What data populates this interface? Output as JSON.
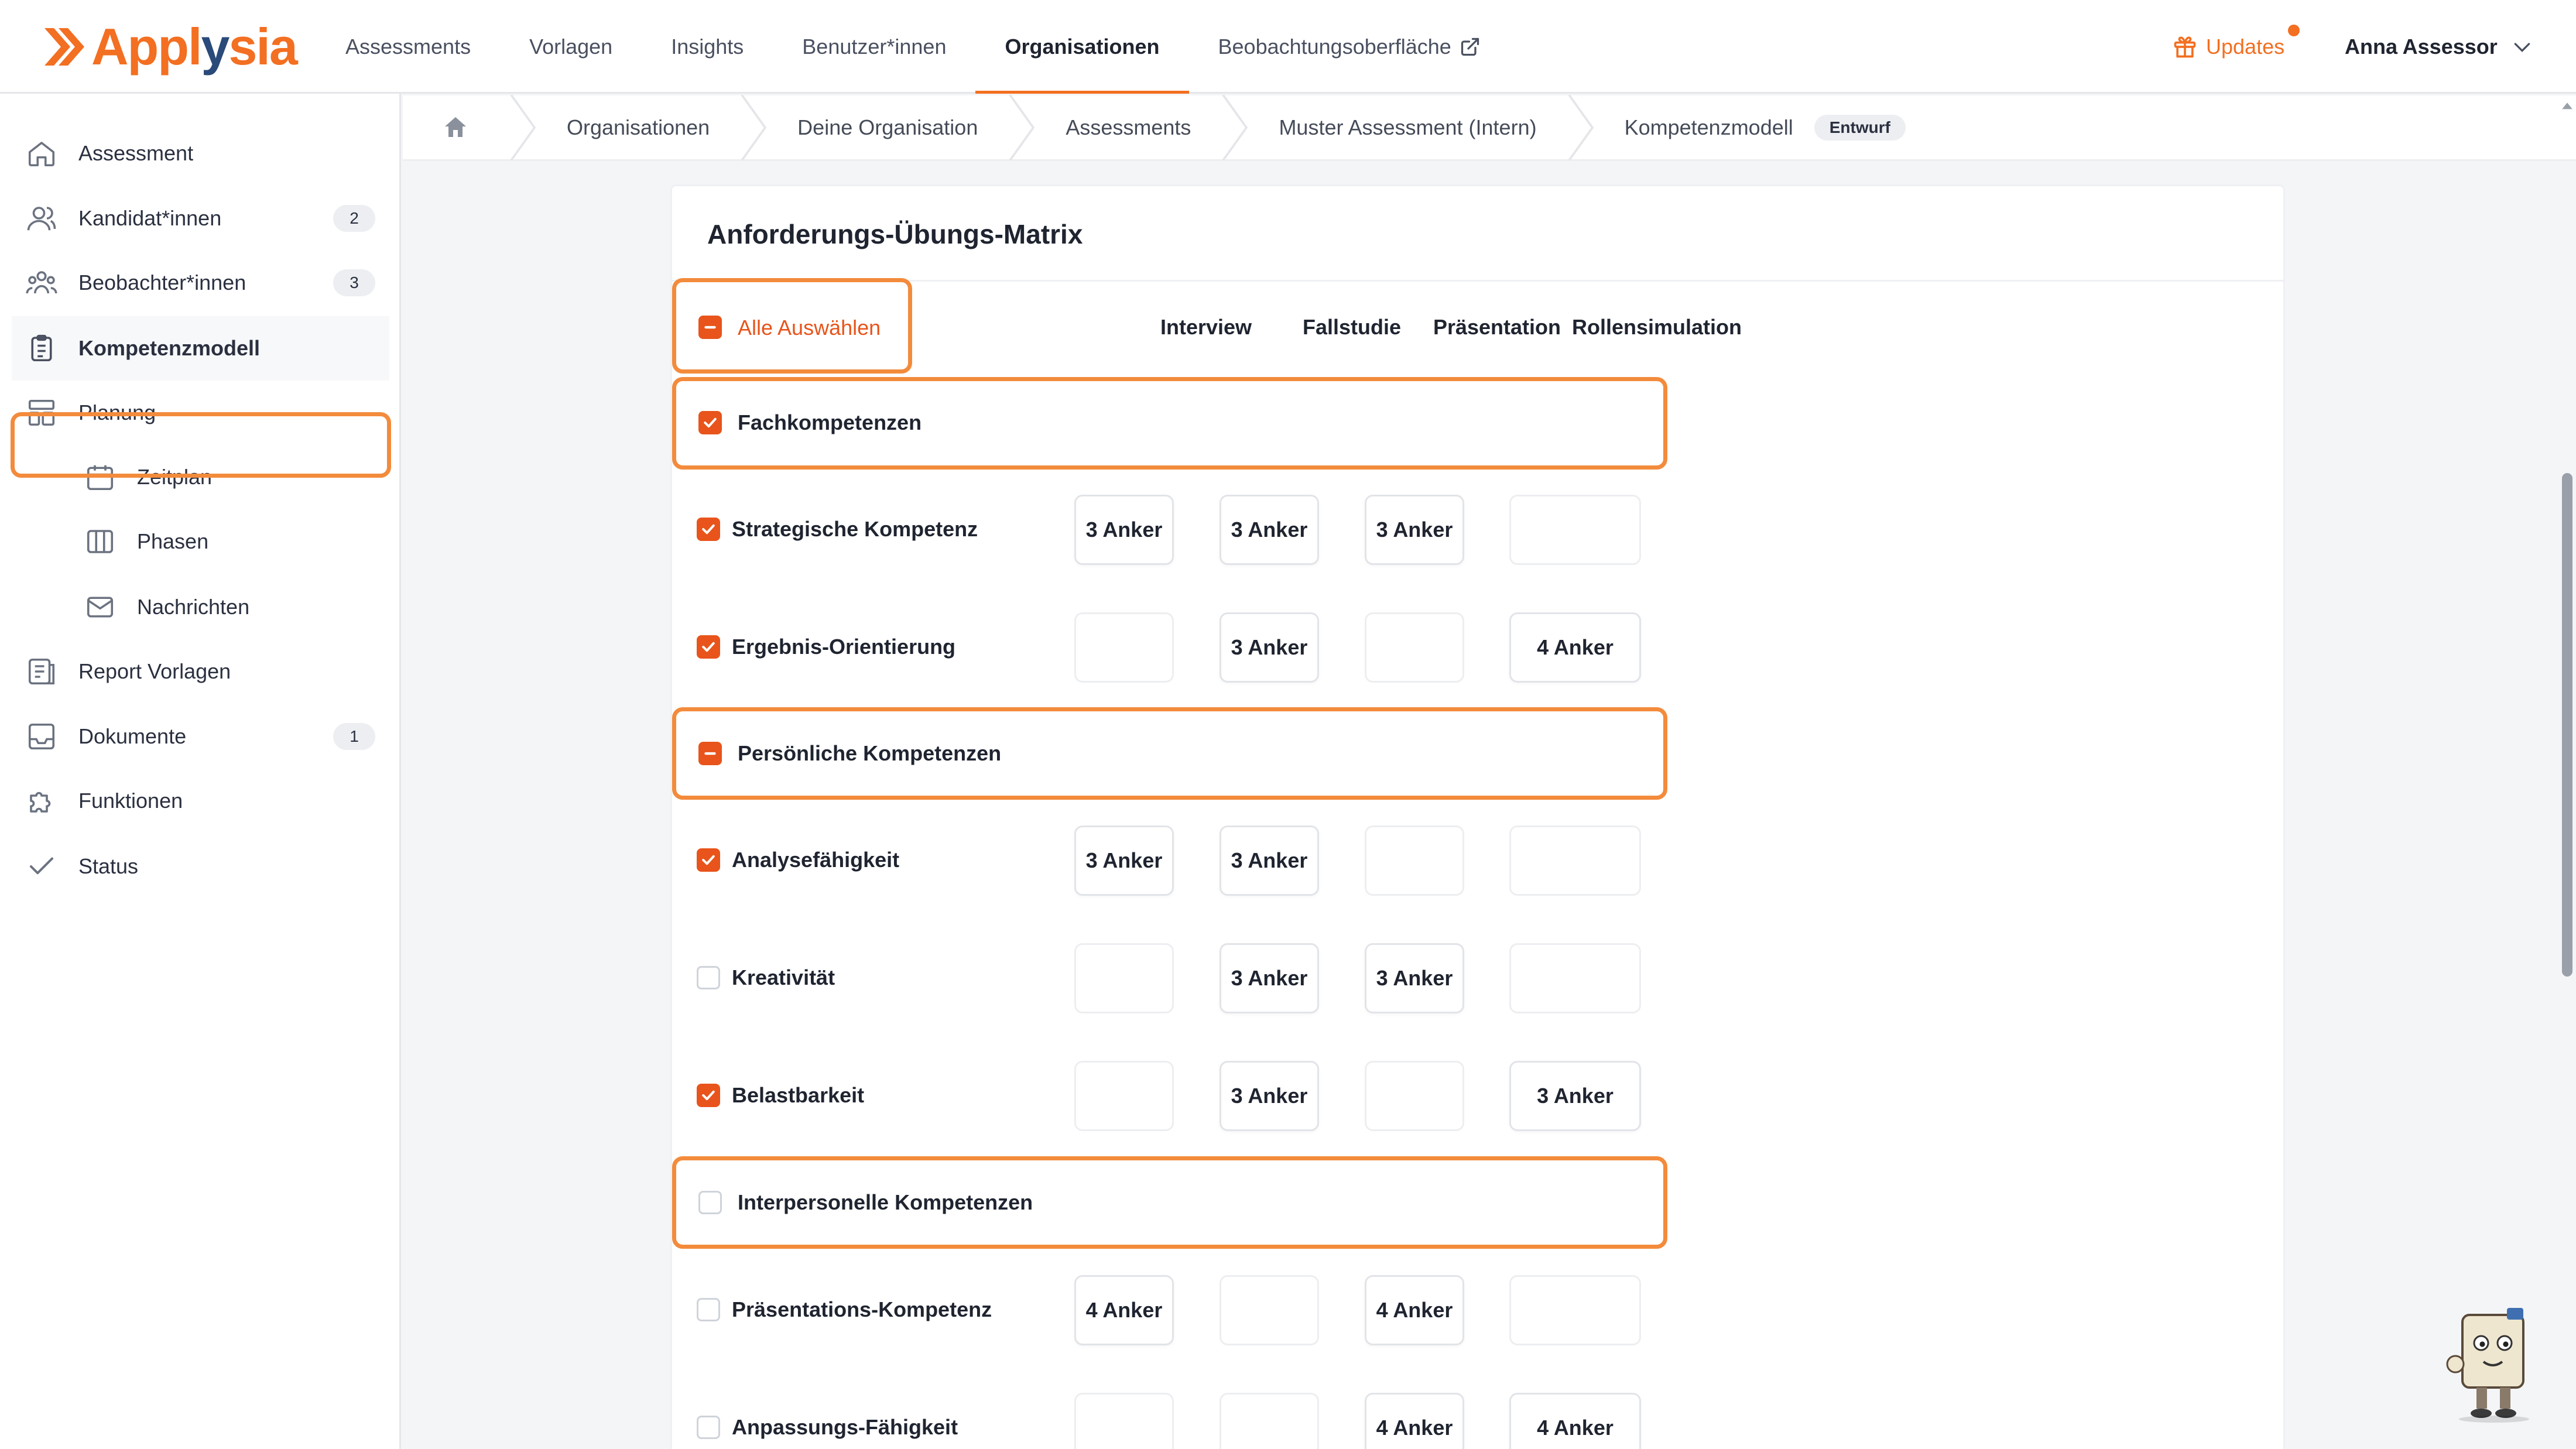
{
  "brand": {
    "name_a": "Appl",
    "name_b": "y",
    "name_c": "sia",
    "color": "#f36f21",
    "accent_dark": "#2a4a7a"
  },
  "topnav": {
    "items": [
      {
        "label": "Assessments"
      },
      {
        "label": "Vorlagen"
      },
      {
        "label": "Insights"
      },
      {
        "label": "Benutzer*innen"
      },
      {
        "label": "Organisationen",
        "active": true
      },
      {
        "label": "Beobachtungsoberfläche",
        "external": true
      }
    ],
    "updates_label": "Updates",
    "user_name": "Anna Assessor"
  },
  "sidebar": {
    "items": [
      {
        "label": "Assessment",
        "icon": "home-icon"
      },
      {
        "label": "Kandidat*innen",
        "icon": "users-icon",
        "badge": "2"
      },
      {
        "label": "Beobachter*innen",
        "icon": "group-icon",
        "badge": "3"
      },
      {
        "label": "Kompetenzmodell",
        "icon": "clipboard-icon",
        "active": true
      },
      {
        "label": "Planung",
        "icon": "layout-icon"
      },
      {
        "label": "Zeitplan",
        "icon": "calendar-icon",
        "sub": true
      },
      {
        "label": "Phasen",
        "icon": "columns-icon",
        "sub": true
      },
      {
        "label": "Nachrichten",
        "icon": "mail-icon",
        "sub": true
      },
      {
        "label": "Report Vorlagen",
        "icon": "report-icon"
      },
      {
        "label": "Dokumente",
        "icon": "inbox-icon",
        "badge": "1"
      },
      {
        "label": "Funktionen",
        "icon": "puzzle-icon"
      },
      {
        "label": "Status",
        "icon": "check-icon"
      }
    ]
  },
  "breadcrumb": {
    "items": [
      "Organisationen",
      "Deine Organisation",
      "Assessments",
      "Muster Assessment (Intern)",
      "Kompetenzmodell"
    ],
    "badge": "Entwurf"
  },
  "matrix": {
    "title": "Anforderungs-Übungs-Matrix",
    "select_all_label": "Alle Auswählen",
    "select_all_state": "indeterminate",
    "columns": [
      "Interview",
      "Fallstudie",
      "Präsentation",
      "Rollensimulation"
    ],
    "rows": [
      {
        "type": "group",
        "label": "Fachkompetenzen",
        "state": "checked"
      },
      {
        "type": "item",
        "label": "Strategische Kompetenz",
        "state": "checked",
        "cells": [
          "3 Anker",
          "3 Anker",
          "3 Anker",
          ""
        ]
      },
      {
        "type": "item",
        "label": "Ergebnis-Orientierung",
        "state": "checked",
        "cells": [
          "",
          "3 Anker",
          "",
          "4 Anker"
        ]
      },
      {
        "type": "group",
        "label": "Persönliche Kompetenzen",
        "state": "indeterminate"
      },
      {
        "type": "item",
        "label": "Analysefähigkeit",
        "state": "checked",
        "cells": [
          "3 Anker",
          "3 Anker",
          "",
          ""
        ]
      },
      {
        "type": "item",
        "label": "Kreativität",
        "state": "unchecked",
        "cells": [
          "",
          "3 Anker",
          "3 Anker",
          ""
        ]
      },
      {
        "type": "item",
        "label": "Belastbarkeit",
        "state": "checked",
        "cells": [
          "",
          "3 Anker",
          "",
          "3 Anker"
        ]
      },
      {
        "type": "group",
        "label": "Interpersonelle Kompetenzen",
        "state": "unchecked"
      },
      {
        "type": "item",
        "label": "Präsentations-Kompetenz",
        "state": "unchecked",
        "cells": [
          "4 Anker",
          "",
          "4 Anker",
          ""
        ]
      },
      {
        "type": "item",
        "label": "Anpassungs-Fähigkeit",
        "state": "unchecked",
        "cells": [
          "",
          "",
          "4 Anker",
          "4 Anker"
        ]
      }
    ]
  }
}
